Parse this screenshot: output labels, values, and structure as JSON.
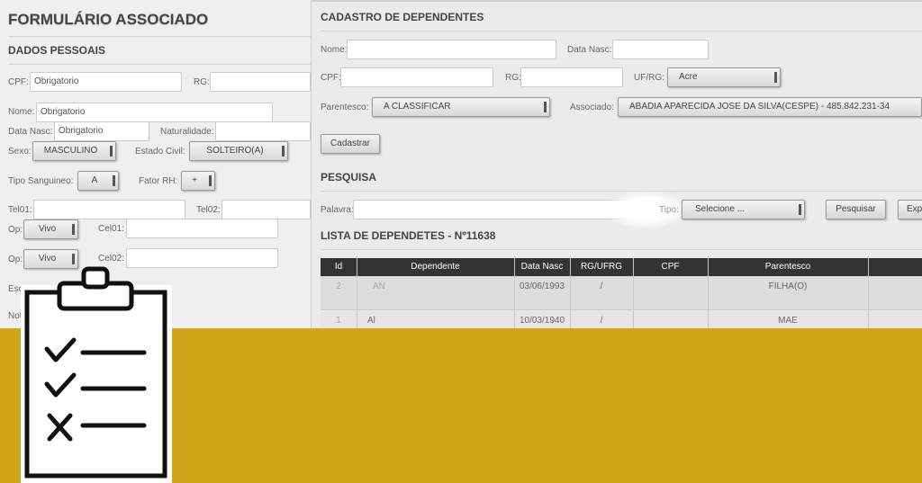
{
  "left_form": {
    "title": "FORMULÁRIO ASSOCIADO",
    "section_title": "DADOS PESSOAIS",
    "cpf_label": "CPF:",
    "cpf_placeholder": "Obrigatorio",
    "rg_label": "RG:",
    "nome_label": "Nome:",
    "nome_placeholder": "Obrigatorio",
    "data_nasc_label": "Data Nasc:",
    "data_nasc_placeholder": "Obrigatorio",
    "naturalidade_label": "Naturalidade:",
    "sexo_label": "Sexo:",
    "sexo_value": "MASCULINO",
    "estado_civil_label": "Estado Civil:",
    "estado_civil_value": "SOLTEIRO(A)",
    "tipo_sanguineo_label": "Tipo Sanguineo:",
    "tipo_sanguineo_value": "A",
    "fator_rh_label": "Fator RH:",
    "fator_rh_value": "+",
    "tel01_label": "Tel01:",
    "tel02_label": "Tel02:",
    "op1_label": "Op:",
    "op1_value": "Vivo",
    "cel01_label": "Cel01:",
    "op2_label": "Op:",
    "op2_value": "Vivo",
    "cel02_label": "Cel02:",
    "esc_label": "Esc",
    "not_label": "Not"
  },
  "dependents": {
    "title": "CADASTRO DE DEPENDENTES",
    "nome_label": "Nome:",
    "data_nasc_label": "Data Nasc:",
    "cpf_label": "CPF:",
    "rg_label": "RG:",
    "uf_rg_label": "UF/RG:",
    "uf_rg_value": "Acre",
    "parentesco_label": "Parentesco:",
    "parentesco_value": "A CLASSIFICAR",
    "associado_label": "Associado:",
    "associado_value": "ABADIA APARECIDA JOSE DA SILVA(CESPE) - 485.842.231-34",
    "cadastrar_button": "Cadastrar"
  },
  "search": {
    "title": "PESQUISA",
    "palavra_label": "Palavra:",
    "tipo_label": "Tipo:",
    "tipo_value": "Selecione ...",
    "pesquisar_button": "Pesquisar",
    "export_button": "Exp"
  },
  "list": {
    "title": "LISTA DE DEPENDETES - Nº11638",
    "columns": [
      "Id",
      "Dependente",
      "Data Nasc",
      "RG/UFRG",
      "CPF",
      "Parentesco"
    ],
    "rows": [
      {
        "id": "2",
        "dependente": "AN",
        "data_nasc": "03/06/1993",
        "rg": "/",
        "cpf": "",
        "parentesco": "FILHA(O)"
      },
      {
        "id": "1",
        "dependente": "Al",
        "data_nasc": "10/03/1940",
        "rg": "/",
        "cpf": "",
        "parentesco": "MAE"
      }
    ]
  },
  "banner": {
    "color": "#d4a419",
    "icon": "clipboard-checklist-icon"
  }
}
